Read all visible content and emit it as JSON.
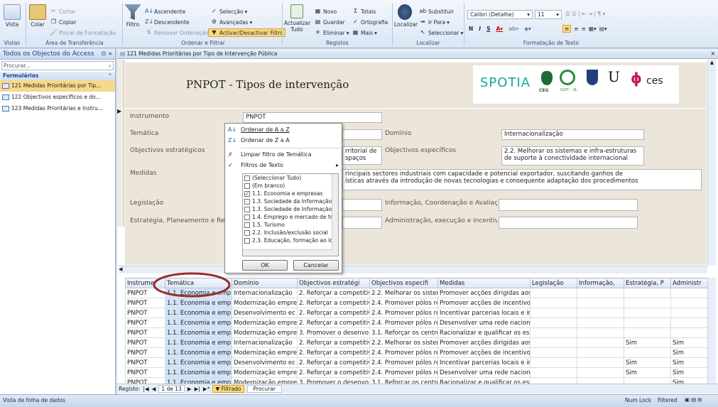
{
  "ribbon": {
    "views": {
      "label": "Vista",
      "group": "Vistas"
    },
    "clipboard": {
      "paste": "Colar",
      "cut": "Cortar",
      "copy": "Copiar",
      "format_painter": "Pincel de Formatação",
      "group": "Área de Transferência"
    },
    "sort_filter": {
      "filter": "Filtro",
      "ascending": "Ascendente",
      "descending": "Descendente",
      "remove_sort": "Remover Ordenação",
      "selection": "Selecção",
      "advanced": "Avançadas",
      "toggle_filter": "Activar/Desactivar Filtro",
      "group": "Ordenar e Filtrar"
    },
    "records": {
      "refresh_all": "Actualizar Tudo",
      "new": "Novo",
      "save": "Guardar",
      "delete": "Eliminar",
      "totals": "Totais",
      "spelling": "Ortografia",
      "more": "Mais",
      "group": "Registos"
    },
    "find": {
      "find": "Localizar",
      "replace": "Substituir",
      "go_to": "Ir Para",
      "select": "Seleccionar",
      "group": "Localizar"
    },
    "text_format": {
      "font": "Calibri (Detalhe)",
      "size": "11",
      "bold": "N",
      "italic": "I",
      "underline": "S",
      "group": "Formatação de Texto"
    }
  },
  "nav": {
    "title": "Todos os Objectos do Access",
    "search_placeholder": "Procurar...",
    "section": "Formulários",
    "items": [
      {
        "label": "121 Medidas Prioritárias por Tip..."
      },
      {
        "label": "122 Objectivos específicos e do..."
      },
      {
        "label": "123 Medidas Prioritárias e Instru..."
      }
    ]
  },
  "document": {
    "tab_title": "121 Medidas Prioritárias por Tipo de Intervenção Pública",
    "form_title": "PNPOT - Tipos de intervenção",
    "logos": {
      "spotia": "SPOTIA",
      "ceg": "CEG",
      "igot": "IGOT - UL",
      "ces": "ces"
    },
    "fields": {
      "instrumento": {
        "label": "Instrumento",
        "value": "PNPOT"
      },
      "tematica": {
        "label": "Temática",
        "value": ""
      },
      "dominio": {
        "label": "Domínio",
        "value": "Internacionalização"
      },
      "obj_estrategicos": {
        "label": "Objectivos estratégicos",
        "value": "rritorial de\nspaços"
      },
      "obj_especificos": {
        "label": "Objectivos específicos",
        "value": "2.2. Melhorar os sistemas e infra-estruturas de suporte à conectividade internacional"
      },
      "medidas": {
        "label": "Medidas",
        "value": "rincipais sectores industriais com capacidade e potencial exportador, suscitando ganhos de\nísticas através da introdução de novas tecnologias e consequente adaptação dos procedimentos"
      },
      "legislacao": {
        "label": "Legislação",
        "value": ""
      },
      "informacao": {
        "label": "Informação, Coordenação e Avaliaçã",
        "value": ""
      },
      "estrategia": {
        "label": "Estratégia, Planeamento e Regu",
        "value": ""
      },
      "administracao": {
        "label": "Administração, execução e incentivo",
        "value": ""
      }
    }
  },
  "filter_popup": {
    "sort_az": "Ordenar de A a Z",
    "sort_za": "Ordenar de Z a A",
    "clear_filter": "Limpar filtro de Temática",
    "text_filters": "Filtros de Texto",
    "options": [
      {
        "label": "(Seleccionar Tudo)",
        "checked": false
      },
      {
        "label": "(Em branco)",
        "checked": false
      },
      {
        "label": "1.1. Economia e empresas",
        "checked": true
      },
      {
        "label": "1.3. Sociedade da Informação e",
        "checked": false
      },
      {
        "label": "1.3. Sociedade de Informação e",
        "checked": false
      },
      {
        "label": "1.4. Emprego e mercado de trat",
        "checked": false
      },
      {
        "label": "1.5. Turismo",
        "checked": false
      },
      {
        "label": "2.2. Inclusão/exclusão social",
        "checked": false
      },
      {
        "label": "2.3. Educação, formação ao lon",
        "checked": false
      }
    ],
    "ok": "OK",
    "cancel": "Cancelar"
  },
  "grid": {
    "columns": [
      "Instrumer",
      "Temática",
      "Domínio",
      "Objectivos estratégi",
      "Objectivos especifi",
      "Medidas",
      "Legislação",
      "Informação,",
      "Estratégia, P",
      "Administr"
    ],
    "rows": [
      [
        "PNPOT",
        "1.1. Economia e emp",
        "Internacionalização",
        "2. Reforçar a competitiv",
        "2.2. Melhorar os sistem",
        "Promover acções dirigidas aos",
        "",
        "",
        "",
        ""
      ],
      [
        "PNPOT",
        "1.1. Economia e emp",
        "Modernização empre",
        "2. Reforçar a competitiv",
        "2.4. Promover pólos re",
        "Promover acções de incentivo",
        "",
        "",
        "",
        ""
      ],
      [
        "PNPOT",
        "1.1. Economia e emp",
        "Desenvolvimento ec",
        "2. Reforçar a competitiv",
        "2.4. Promover pólos re",
        "Incentivar parcerias locais e in",
        "",
        "",
        "",
        ""
      ],
      [
        "PNPOT",
        "1.1. Economia e emp",
        "Modernização empre",
        "2. Reforçar a competitiv",
        "2.4. Promover pólos re",
        "Desenvolver uma rede nacion",
        "",
        "",
        "",
        ""
      ],
      [
        "PNPOT",
        "1.1. Economia e emp",
        "Modernização empre",
        "3. Promover o desenvo",
        "3.1. Reforçar os centro",
        "Racionalizar e qualificar os esp",
        "",
        "",
        "",
        ""
      ],
      [
        "PNPOT",
        "1.1. Economia e emp",
        "Internacionalização",
        "2. Reforçar a competitiv",
        "2.2. Melhorar os sistem",
        "Promover acções dirigidas aos",
        "",
        "",
        "Sim",
        "Sim"
      ],
      [
        "PNPOT",
        "1.1. Economia e emp",
        "Modernização empre",
        "2. Reforçar a competitiv",
        "2.4. Promover pólos re",
        "Promover acções de incentivo",
        "",
        "",
        "",
        "Sim"
      ],
      [
        "PNPOT",
        "1.1. Economia e emp",
        "Desenvolvimento ec",
        "2. Reforçar a competitiv",
        "2.4. Promover pólos re",
        "Incentivar parcerias locais e in",
        "",
        "",
        "Sim",
        "Sim"
      ],
      [
        "PNPOT",
        "1.1. Economia e emp",
        "Modernização empre",
        "2. Reforçar a competitiv",
        "2.4. Promover pólos re",
        "Desenvolver uma rede nacion",
        "",
        "",
        "Sim",
        "Sim"
      ],
      [
        "PNPOT",
        "1.1. Economia e emp",
        "Modernização empre",
        "3. Promover o desenvo",
        "3.1. Reforçar os centro",
        "Racionalizar e qualificar os esp",
        "",
        "",
        "",
        "Sim"
      ]
    ]
  },
  "record_nav": {
    "label": "Registo:",
    "position": "1 de 13",
    "filtered": "Filtrado",
    "search": "Procurar"
  },
  "status": {
    "left": "Vista de folha de dados",
    "num_lock": "Num Lock",
    "filtered": "Filtered"
  },
  "colors": {
    "accent": "#15428b",
    "highlight": "#f6d88b",
    "annotation": "#9b2b2b",
    "spotia": "#1aa3a3",
    "ces": "#c2185b"
  }
}
